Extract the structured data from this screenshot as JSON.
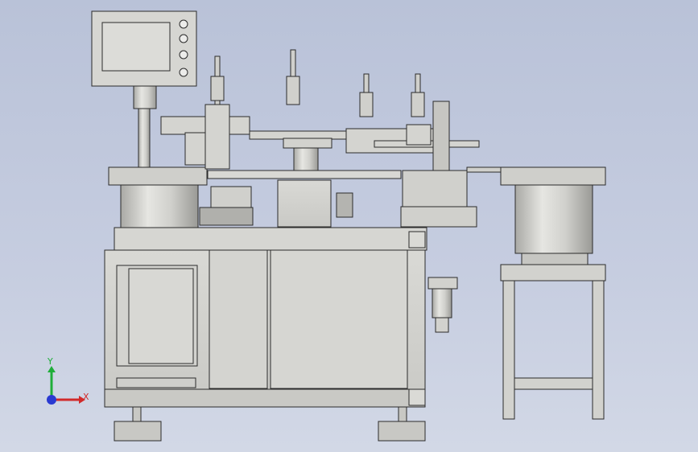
{
  "viewport": {
    "title": "",
    "background": "#c3cadd"
  },
  "triad": {
    "x_label": "X",
    "y_label": "Y",
    "x_color": "#d12a2a",
    "y_color": "#1fae3a",
    "z_color": "#2a3ad1",
    "icon": "coordinate-triad-icon"
  },
  "model": {
    "name": "",
    "components": [
      "touch-screen-panel",
      "feeding-bowl-left",
      "feeding-bowl-right",
      "rotary-indexing-table",
      "pneumatic-cylinder",
      "linear-slide",
      "main-cabinet",
      "feeder-stand",
      "filter-regulator",
      "leveling-foot"
    ],
    "colors": {
      "metal_light": "#d6d6d2",
      "metal_mid": "#b8b8b4",
      "metal_dark": "#8c8c88",
      "edge": "#2b2b2b"
    }
  }
}
